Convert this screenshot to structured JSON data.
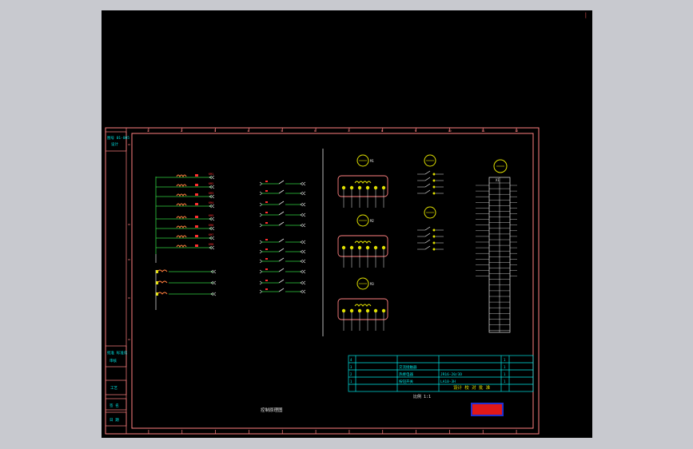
{
  "viewport": {
    "corner_mark": "|",
    "colors": {
      "background": "#000000",
      "app_background": "#c8c9cf",
      "frame": "#ff8080",
      "wire_green": "#30d040",
      "wire_white": "#e8e8e8",
      "coil": "#ff7d3c",
      "label_red": "#ff3030",
      "table_cyan": "#00e5e5",
      "title_yellow": "#e0e000",
      "stamp_red": "#e01818",
      "stamp_blue": "#2030d0"
    }
  },
  "drawing": {
    "caption": "控制原理图",
    "title_block_caption": "设计 校 对 批 准",
    "table_number_label": "比例 1:1",
    "nameplate_text": "",
    "left_strip": {
      "top_label": "图号 01-005",
      "top_sub": "设计",
      "mid_label": "批准 标准化",
      "mid_sub": "审核",
      "low_label": "工艺",
      "sign1": "签 名",
      "sign2": "日 期"
    },
    "ruler_numbers": [
      "1",
      "2",
      "3",
      "4",
      "5",
      "6",
      "7",
      "8",
      "9",
      "10",
      "11",
      "12"
    ],
    "title_rows": [
      {
        "no": "4",
        "desc": "",
        "part": "",
        "spec": "",
        "qty": "1"
      },
      {
        "no": "3",
        "desc": "",
        "part": "交流接触器",
        "spec": "",
        "qty": "1"
      },
      {
        "no": "2",
        "desc": "",
        "part": "热继电器",
        "spec": "JR16-20/3D",
        "qty": "1"
      },
      {
        "no": "1",
        "desc": "",
        "part": "按钮开关",
        "spec": "LA10-3H",
        "qty": "1"
      }
    ],
    "title_header": [
      "序号",
      "名 称",
      "型 号",
      "数量"
    ],
    "motor_labels": [
      "M1",
      "M2",
      "M3"
    ],
    "terminal_header": "X1",
    "coil_labels": [
      "KM1",
      "KM2",
      "KM3",
      "KM4",
      "KM5",
      "KM6",
      "KM7",
      "KM8"
    ],
    "mid_labels": [
      "SB1",
      "SB2",
      "SB3",
      "SB4",
      "SB5"
    ]
  }
}
